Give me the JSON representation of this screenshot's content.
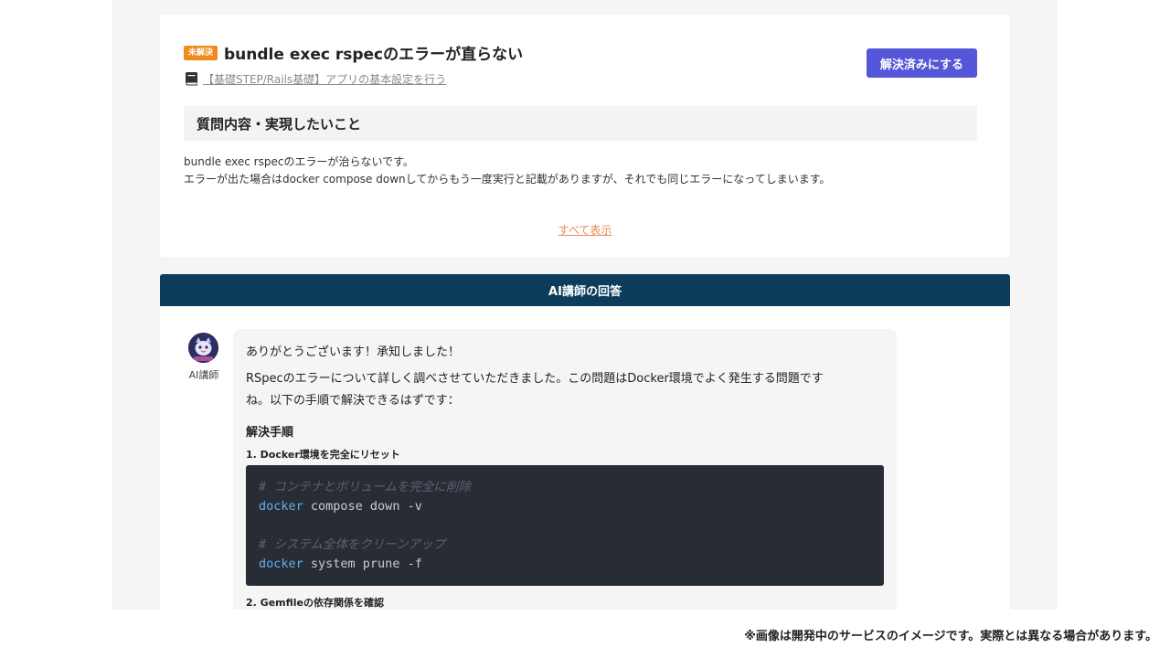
{
  "question": {
    "status_badge": "未解決",
    "title": "bundle exec rspecのエラーが直らない",
    "lesson_link": "【基礎STEP/Rails基礎】アプリの基本設定を行う",
    "resolve_button": "解決済みにする",
    "section_heading": "質問内容・実現したいこと",
    "body_line1": "bundle exec rspecのエラーが治らないです。",
    "body_line2": "エラーが出た場合はdocker compose downしてからもう一度実行と記載がありますが、それでも同じエラーになってしまいます。",
    "show_all": "すべて表示"
  },
  "answer": {
    "header": "AI講師の回答",
    "author": "AI講師",
    "greeting": "ありがとうございます！承知しました！",
    "intro_line1": "RSpecのエラーについて詳しく調べさせていただきました。この問題はDocker環境でよく発生する問題です",
    "intro_line2": "ね。以下の手順で解決できるはずです：",
    "steps_heading": "解決手順",
    "step1": "1. Docker環境を完全にリセット",
    "code": {
      "comment1": "# コンテナとボリュームを完全に削除",
      "cmd1": "docker",
      "args1": " compose down -v",
      "comment2": "# システム全体をクリーンアップ",
      "cmd2": "docker",
      "args2": " system prune -f"
    },
    "step2": "2. Gemfileの依存関係を確認"
  },
  "disclaimer": "※画像は開発中のサービスのイメージです。実際とは異なる場合があります。",
  "colors": {
    "badge": "#f08c1c",
    "button": "#5557d8",
    "answer_header": "#0e3d5b",
    "link_accent": "#e98b5a",
    "code_bg": "#282c34"
  },
  "icons": [
    "book-icon",
    "ai-cat-avatar-icon"
  ]
}
